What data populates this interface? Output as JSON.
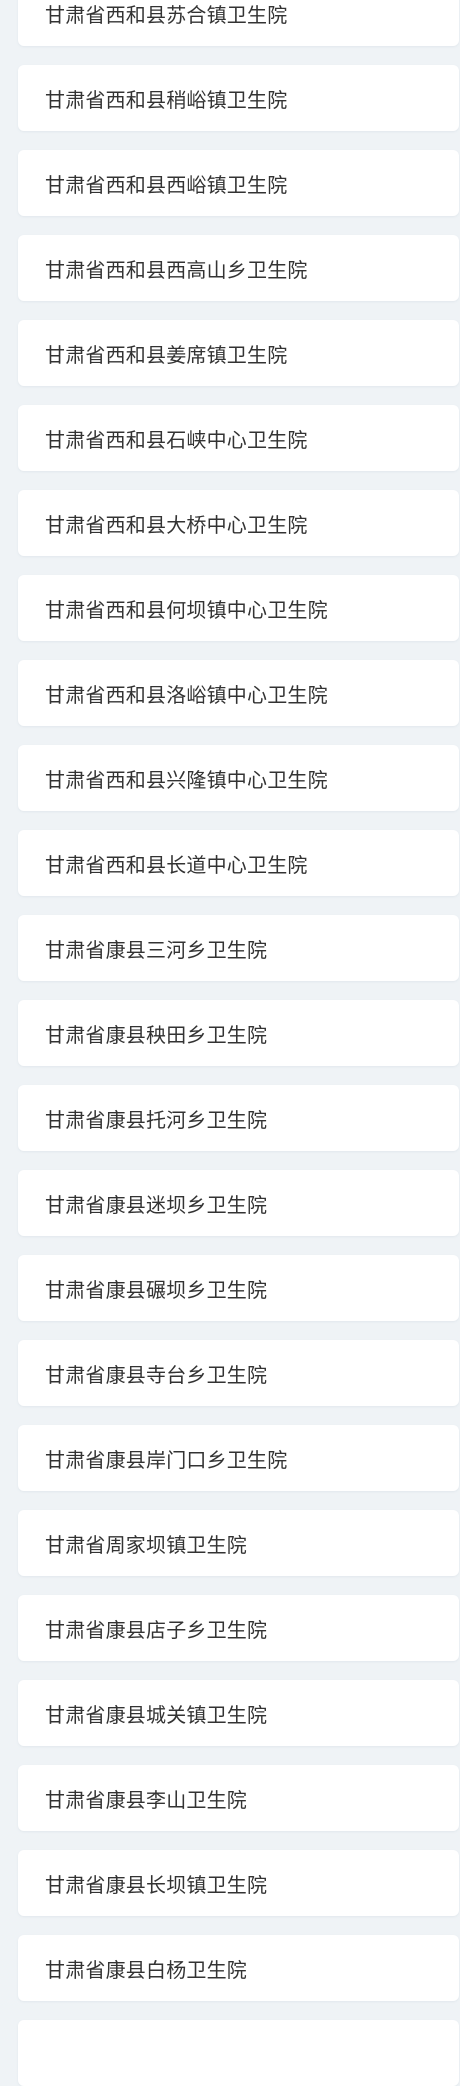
{
  "items": [
    "甘肃省西和县苏合镇卫生院",
    "甘肃省西和县稍峪镇卫生院",
    "甘肃省西和县西峪镇卫生院",
    "甘肃省西和县西高山乡卫生院",
    "甘肃省西和县姜席镇卫生院",
    "甘肃省西和县石峡中心卫生院",
    "甘肃省西和县大桥中心卫生院",
    "甘肃省西和县何坝镇中心卫生院",
    "甘肃省西和县洛峪镇中心卫生院",
    "甘肃省西和县兴隆镇中心卫生院",
    "甘肃省西和县长道中心卫生院",
    "甘肃省康县三河乡卫生院",
    "甘肃省康县秧田乡卫生院",
    "甘肃省康县托河乡卫生院",
    "甘肃省康县迷坝乡卫生院",
    "甘肃省康县碾坝乡卫生院",
    "甘肃省康县寺台乡卫生院",
    "甘肃省康县岸门口乡卫生院",
    "甘肃省周家坝镇卫生院",
    "甘肃省康县店子乡卫生院",
    "甘肃省康县城关镇卫生院",
    "甘肃省康县李山卫生院",
    "甘肃省康县长坝镇卫生院",
    "甘肃省康县白杨卫生院",
    ""
  ]
}
